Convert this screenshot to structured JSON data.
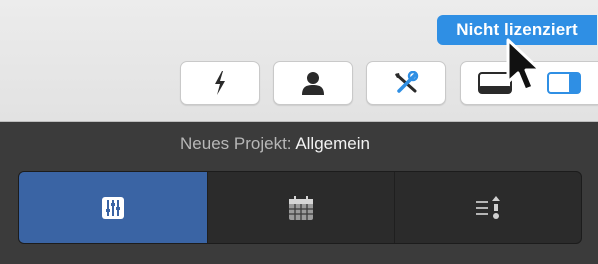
{
  "license": {
    "label": "Nicht lizenziert",
    "color": "#2f8fe4"
  },
  "toolbar": {
    "buttons": [
      {
        "name": "action",
        "icon": "lightning-icon"
      },
      {
        "name": "user",
        "icon": "person-icon"
      },
      {
        "name": "tools",
        "icon": "tools-icon"
      }
    ],
    "layout": {
      "bottom_icon": "layout-bottom-panel-icon",
      "right_icon": "layout-right-panel-icon",
      "active_color": "#2f8fe4"
    }
  },
  "panel": {
    "title_prefix": "Neues Projekt:",
    "title_name": "Allgemein",
    "tabs": [
      {
        "id": "general",
        "icon": "sliders-icon",
        "selected": true
      },
      {
        "id": "calendar",
        "icon": "calendar-icon",
        "selected": false
      },
      {
        "id": "list",
        "icon": "list-sort-icon",
        "selected": false
      }
    ],
    "selected_color": "#3a64a4"
  }
}
